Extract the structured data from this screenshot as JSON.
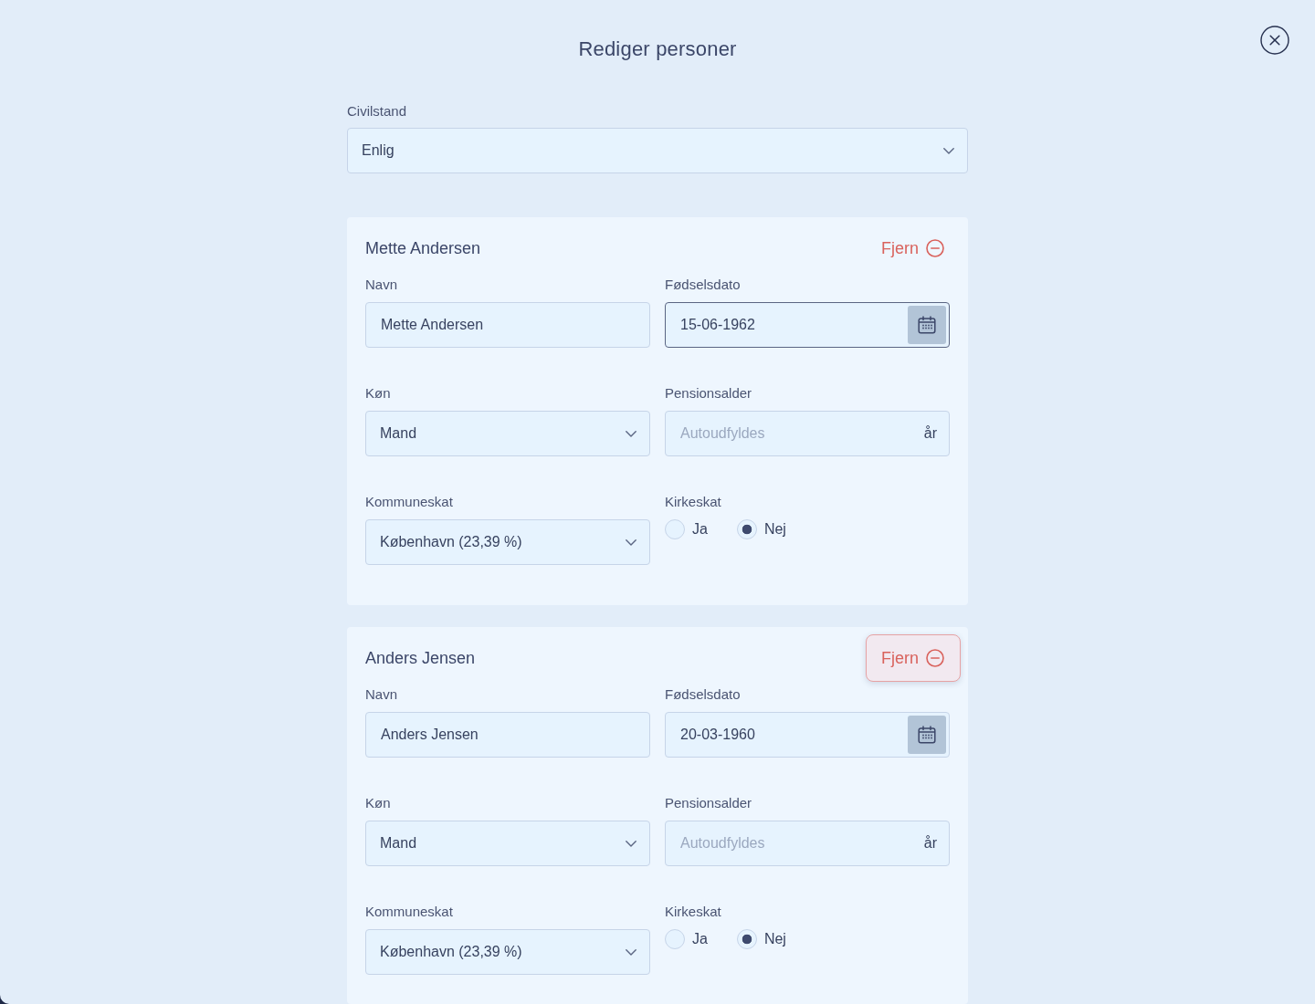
{
  "dialog": {
    "title": "Rediger personer"
  },
  "marital_status": {
    "label": "Civilstand",
    "value": "Enlig"
  },
  "persons": [
    {
      "name": "Mette Andersen",
      "remove_button": {
        "label": "Fjern",
        "hovered": false
      },
      "fields": [
        {
          "kind": "text",
          "label": "Navn",
          "value": "Mette Andersen"
        },
        {
          "kind": "date",
          "label": "Fødselsdato",
          "value": "15-06-1962",
          "focused": true
        },
        {
          "kind": "select",
          "label": "Køn",
          "value": "Mand"
        },
        {
          "kind": "unit",
          "label": "Pensionsalder",
          "placeholder": "Autoudfyldes",
          "unit": "år"
        },
        {
          "kind": "select",
          "label": "Kommuneskat",
          "value": "København (23,39 %)"
        },
        {
          "kind": "radio",
          "label": "Kirkeskat",
          "options": [
            {
              "label": "Ja",
              "selected": false
            },
            {
              "label": "Nej",
              "selected": true
            }
          ]
        }
      ]
    },
    {
      "name": "Anders Jensen",
      "remove_button": {
        "label": "Fjern",
        "hovered": true
      },
      "fields": [
        {
          "kind": "text",
          "label": "Navn",
          "value": "Anders Jensen"
        },
        {
          "kind": "date",
          "label": "Fødselsdato",
          "value": "20-03-1960",
          "focused": false
        },
        {
          "kind": "select",
          "label": "Køn",
          "value": "Mand"
        },
        {
          "kind": "unit",
          "label": "Pensionsalder",
          "placeholder": "Autoudfyldes",
          "unit": "år"
        },
        {
          "kind": "select",
          "label": "Kommuneskat",
          "value": "København (23,39 %)"
        },
        {
          "kind": "radio",
          "label": "Kirkeskat",
          "options": [
            {
              "label": "Ja",
              "selected": false
            },
            {
              "label": "Nej",
              "selected": true
            }
          ]
        }
      ]
    }
  ]
}
